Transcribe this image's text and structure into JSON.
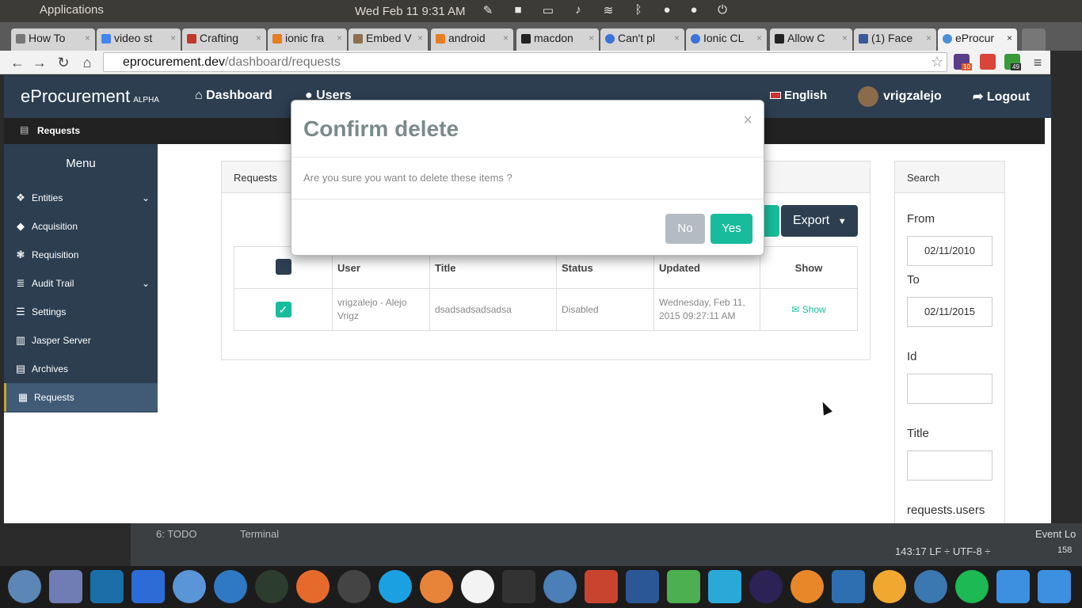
{
  "system": {
    "apps_label": "Applications",
    "clock": "Wed Feb 11  9:31 AM"
  },
  "browser": {
    "tabs": [
      "How To",
      "video st",
      "Crafting",
      "ionic fra",
      "Embed V",
      "android",
      "macdon",
      "Can't pl",
      "Ionic CL",
      "Allow C",
      "(1) Face",
      "eProcur"
    ],
    "url_host": "eprocurement.dev",
    "url_path": "/dashboard/requests",
    "ext_badges": [
      "10",
      "49"
    ]
  },
  "app": {
    "brand": "eProcurement",
    "brand_tag": "ALPHA",
    "nav": {
      "dashboard": "Dashboard",
      "users": "Users",
      "language": "English",
      "user": "vrigzalejo",
      "logout": "Logout"
    },
    "subbar_label": "Requests",
    "sidebar": {
      "title": "Menu",
      "items": [
        {
          "label": "Entities"
        },
        {
          "label": "Acquisition"
        },
        {
          "label": "Requisition"
        },
        {
          "label": "Audit Trail"
        },
        {
          "label": "Settings"
        },
        {
          "label": "Jasper Server"
        },
        {
          "label": "Archives"
        },
        {
          "label": "Requests"
        }
      ]
    },
    "requests_panel": {
      "title": "Requests",
      "export_label": "Export",
      "columns": [
        "User",
        "Title",
        "Status",
        "Updated",
        "Show"
      ],
      "row": {
        "user": "vrigzalejo - Alejo Vrigz",
        "title": "dsadsadsadsadsa",
        "status": "Disabled",
        "updated": "Wednesday, Feb 11, 2015 09:27:11 AM",
        "show": "Show"
      }
    },
    "search_panel": {
      "title": "Search",
      "from_label": "From",
      "from_value": "02/11/2010",
      "to_label": "To",
      "to_value": "02/11/2015",
      "id_label": "Id",
      "title_label": "Title",
      "users_label": "requests.users"
    }
  },
  "modal": {
    "title": "Confirm delete",
    "close": "×",
    "body": "Are you sure you want to delete these items ?",
    "no": "No",
    "yes": "Yes"
  },
  "ide": {
    "todo": "6: TODO",
    "terminal": "Terminal",
    "event_log": "Event Lo",
    "status": "143:17   LF ÷  UTF-8 ÷",
    "count": "158"
  },
  "colors": {
    "primary": "#2c3e50",
    "success": "#18bc9c",
    "muted": "#b4bcc2"
  }
}
